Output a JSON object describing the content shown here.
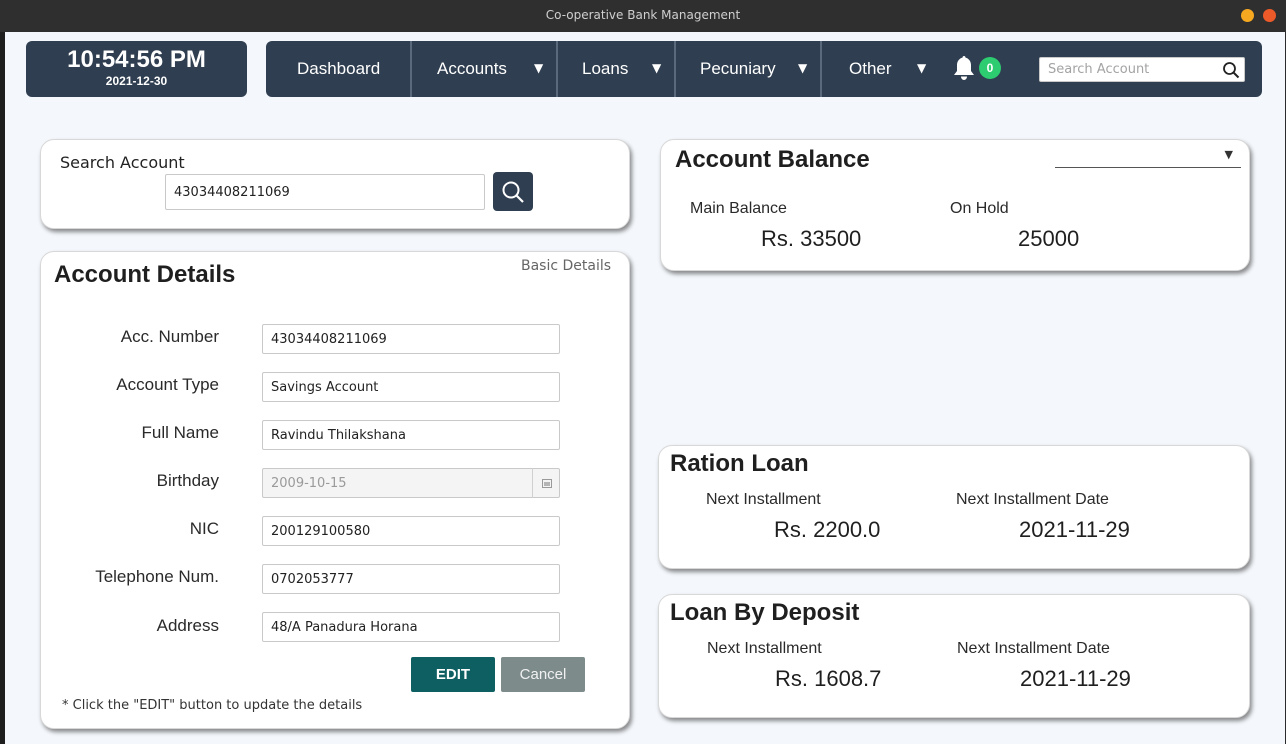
{
  "window": {
    "title": "Co-operative Bank Management"
  },
  "clock": {
    "time": "10:54:56 PM",
    "date": "2021-12-30"
  },
  "nav": {
    "items": [
      "Dashboard",
      "Accounts",
      "Loans",
      "Pecuniary",
      "Other"
    ],
    "notification_count": "0",
    "search_placeholder": "Search Account"
  },
  "search": {
    "label": "Search Account",
    "value": "43034408211069"
  },
  "details": {
    "title": "Account Details",
    "subtitle": "Basic Details",
    "fields": [
      {
        "label": "Acc. Number",
        "value": "43034408211069"
      },
      {
        "label": "Account Type",
        "value": "Savings Account"
      },
      {
        "label": "Full Name",
        "value": "Ravindu Thilakshana"
      },
      {
        "label": "Birthday",
        "value": "2009-10-15"
      },
      {
        "label": "NIC",
        "value": "200129100580"
      },
      {
        "label": "Telephone Num.",
        "value": "0702053777"
      },
      {
        "label": "Address",
        "value": "48/A Panadura Horana"
      }
    ],
    "edit_label": "EDIT",
    "cancel_label": "Cancel",
    "note": "* Click the \"EDIT\" button to update the details"
  },
  "balance": {
    "title": "Account Balance",
    "main_label": "Main Balance",
    "main_value": "Rs. 33500",
    "hold_label": "On Hold",
    "hold_value": "25000"
  },
  "loans": [
    {
      "title": "Ration Loan",
      "installment_label": "Next Installment",
      "installment_value": "Rs. 2200.0",
      "date_label": "Next Installment Date",
      "date_value": "2021-11-29"
    },
    {
      "title": "Loan By Deposit",
      "installment_label": "Next Installment",
      "installment_value": "Rs. 1608.7",
      "date_label": "Next Installment Date",
      "date_value": "2021-11-29"
    }
  ],
  "colors": {
    "primary_dark": "#2f3e50",
    "edit_button": "#0d5f61",
    "cancel_button": "#7e8b8b",
    "badge": "#2ecc71"
  }
}
